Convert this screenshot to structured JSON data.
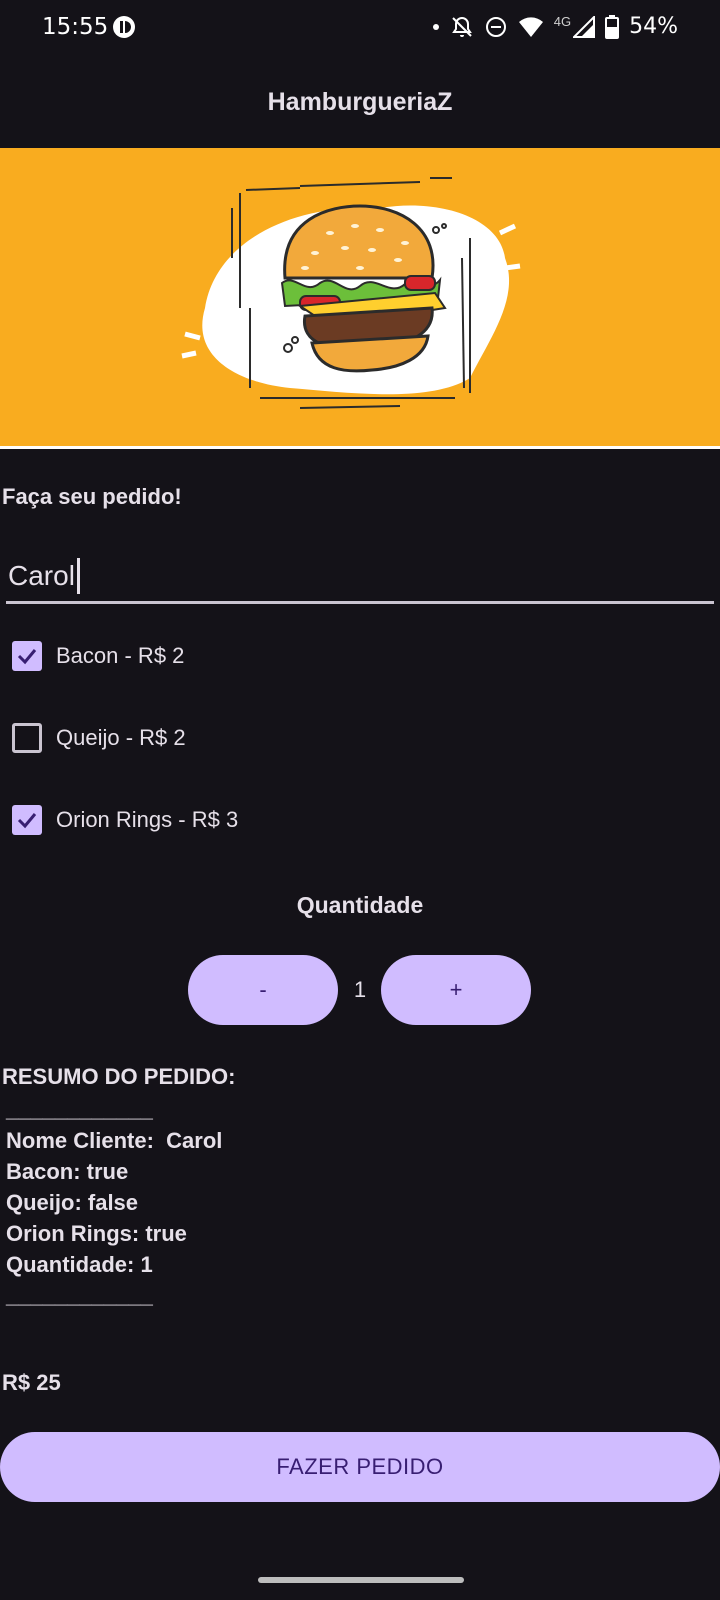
{
  "status_bar": {
    "time": "15:55",
    "network": "4G",
    "battery": "54%",
    "icons": [
      "notification-dot",
      "bell-off-icon",
      "do-not-disturb-icon",
      "wifi-icon",
      "signal-icon",
      "battery-icon"
    ]
  },
  "app_bar": {
    "title": "HamburgueriaZ"
  },
  "banner": {
    "image": "burger-illustration",
    "background": "#f9ac1f"
  },
  "form": {
    "section_title": "Faça seu pedido!",
    "name_value": "Carol",
    "options": [
      {
        "label": "Bacon - R$ 2",
        "checked": true
      },
      {
        "label": "Queijo - R$ 2",
        "checked": false
      },
      {
        "label": "Orion Rings - R$ 3",
        "checked": true
      }
    ]
  },
  "quantity": {
    "title": "Quantidade",
    "minus_label": "-",
    "value": "1",
    "plus_label": "+"
  },
  "summary": {
    "title": "RESUMO DO PEDIDO:",
    "separator": "____________",
    "customer": "Nome Cliente:  Carol",
    "bacon": "Bacon: true",
    "queijo": "Queijo: false",
    "onion": "Orion Rings: true",
    "quantity": "Quantidade: 1",
    "separator_end": "____________"
  },
  "total": "R$ 25",
  "order_button": "FAZER PEDIDO",
  "colors": {
    "accent": "#d0bcff",
    "on_accent": "#381e72",
    "background": "#141218",
    "text": "#e6e0e9"
  }
}
